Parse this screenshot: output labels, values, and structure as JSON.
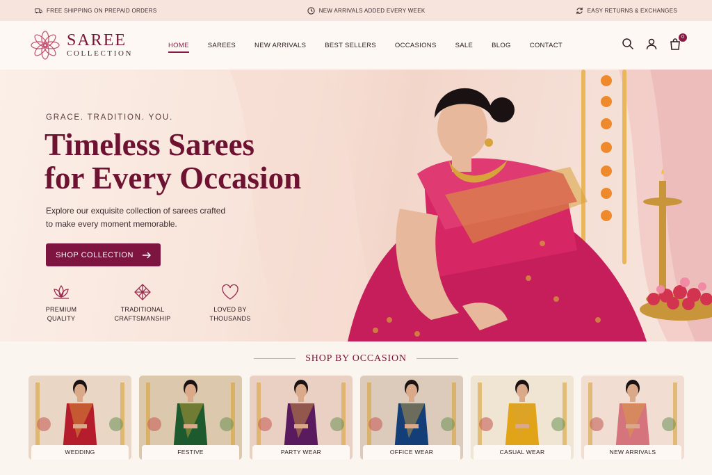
{
  "topbar": {
    "shipping": "FREE SHIPPING ON PREPAID ORDERS",
    "arrivals": "NEW ARRIVALS ADDED EVERY WEEK",
    "returns": "EASY RETURNS & EXCHANGES"
  },
  "brand": {
    "name": "SAREE",
    "sub": "COLLECTION",
    "color": "#7a1437"
  },
  "nav": {
    "items": [
      "HOME",
      "SAREES",
      "NEW ARRIVALS",
      "BEST SELLERS",
      "OCCASIONS",
      "SALE",
      "BLOG",
      "CONTACT"
    ],
    "active": "HOME"
  },
  "header_icons": {
    "search": "search-icon",
    "account": "user-icon",
    "cart": "bag-icon",
    "cart_count": "0"
  },
  "hero": {
    "eyebrow": "GRACE. TRADITION. YOU.",
    "headline_line1": "Timeless Sarees",
    "headline_line2": "for Every Occasion",
    "subtext": "Explore our exquisite collection of sarees crafted to make every moment memorable.",
    "cta": "SHOP COLLECTION",
    "features": [
      {
        "icon": "lotus-icon",
        "label_line1": "PREMIUM",
        "label_line2": "QUALITY"
      },
      {
        "icon": "weave-icon",
        "label_line1": "TRADITIONAL",
        "label_line2": "CRAFTSMANSHIP"
      },
      {
        "icon": "heart-icon",
        "label_line1": "LOVED BY",
        "label_line2": "THOUSANDS"
      }
    ]
  },
  "occasions": {
    "title": "SHOP BY OCCASION",
    "cards": [
      {
        "label": "WEDDING",
        "saree_color": "#b51d2c",
        "bg": "#e9d6c4"
      },
      {
        "label": "FESTIVE",
        "saree_color": "#1d5a2e",
        "bg": "#dcc8ad"
      },
      {
        "label": "PARTY WEAR",
        "saree_color": "#5a1a5e",
        "bg": "#ead0c2"
      },
      {
        "label": "OFFICE WEAR",
        "saree_color": "#143e78",
        "bg": "#dccbbb"
      },
      {
        "label": "CASUAL WEAR",
        "saree_color": "#e1a318",
        "bg": "#f0e4d2"
      },
      {
        "label": "NEW ARRIVALS",
        "saree_color": "#d5747d",
        "bg": "#f1ddd2"
      }
    ]
  },
  "colors": {
    "accent": "#7d1540",
    "topbar_bg": "#f7e4dc",
    "page_bg": "#fbf5ef"
  }
}
